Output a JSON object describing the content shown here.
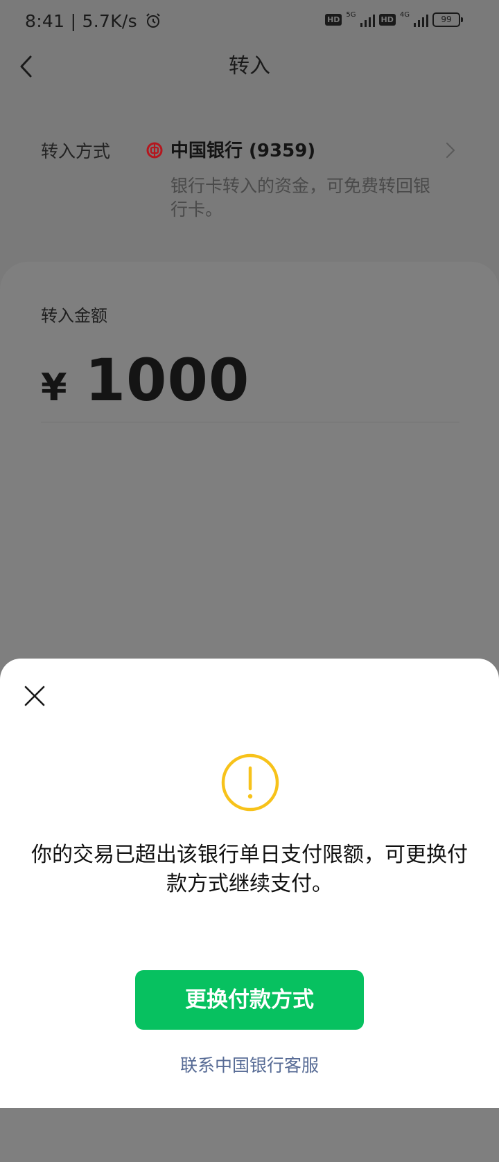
{
  "status_bar": {
    "time": "8:41 | 5.7K/s",
    "hd_label": "HD",
    "net_1": "5G",
    "net_2": "4G",
    "battery": "99"
  },
  "nav": {
    "title": "转入"
  },
  "transfer_method": {
    "label": "转入方式",
    "bank": "中国银行 (9359)",
    "note": "银行卡转入的资金，可免费转回银行卡。"
  },
  "amount": {
    "label": "转入金额",
    "currency": "¥",
    "value": "1000"
  },
  "dialog": {
    "message": "你的交易已超出该银行单日支付限额，可更换付款方式继续支付。",
    "primary_button": "更换付款方式",
    "link": "联系中国银行客服"
  },
  "colors": {
    "accent_green": "#07c160",
    "link_blue": "#576b95",
    "warning_yellow": "#f7c21a",
    "bank_red": "#b5161e"
  }
}
